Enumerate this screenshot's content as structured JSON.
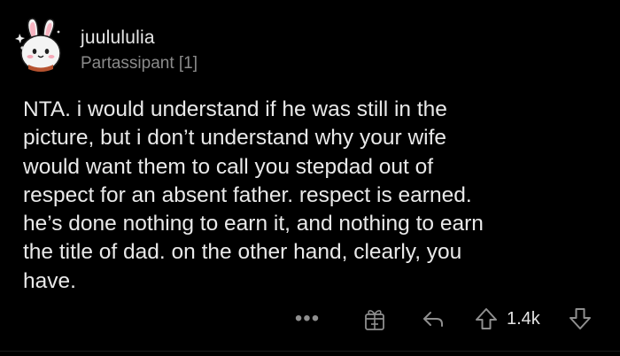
{
  "comment": {
    "author": "juulululia",
    "flair": "Partassipant [1]",
    "body": "NTA. i would understand if he was still in the\npicture, but i don’t understand why your wife\nwould want them to call you stepdad out of\nrespect for an absent father. respect is earned.\nhe’s done nothing to earn it, and nothing to earn\nthe title of dad. on the other hand, clearly, you\nhave.",
    "score": "1.4k"
  },
  "actions": {
    "more_label": "•••",
    "icons": [
      "more-options-icon",
      "award-icon",
      "reply-icon",
      "upvote-icon",
      "downvote-icon"
    ]
  },
  "colors": {
    "background": "#000000",
    "text": "#e9e9e9",
    "muted": "#8b8b8b",
    "icon": "#8f8f8f"
  }
}
